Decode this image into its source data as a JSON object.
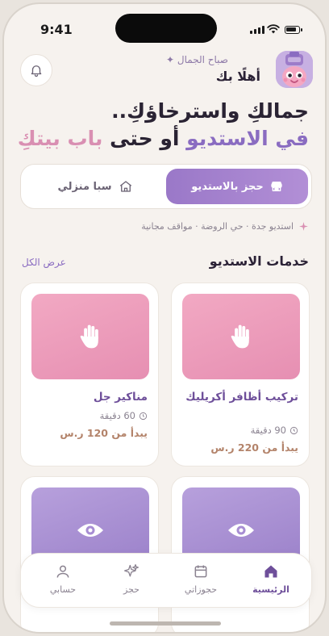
{
  "status": {
    "time": "9:41"
  },
  "header": {
    "greeting_small": "صباح الجمال ✦",
    "greeting_big": "أهلًا بك"
  },
  "hero": {
    "line1": "جمالكِ واسترخاؤكِ..",
    "line2_part1": "في الاستديو",
    "line2_part2": "أو حتى",
    "line2_part3": "باب بيتكِ"
  },
  "toggle": {
    "studio_label": "حجز بالاستديو",
    "home_label": "سبا منزلي"
  },
  "location": {
    "text": "استديو جدة · حي الروضة · مواقف مجانية"
  },
  "section": {
    "title": "خدمات الاستديو",
    "see_all": "عرض الكل"
  },
  "services": [
    {
      "name": "تركيب أظافر أكريليك",
      "duration": "90 دقيقة",
      "price": "يبدأ من 220 ر.س",
      "icon": "hand-icon",
      "color": "pink"
    },
    {
      "name": "مناكير جل",
      "duration": "60 دقيقة",
      "price": "يبدأ من 120 ر.س",
      "icon": "hand-icon",
      "color": "pink"
    },
    {
      "icon": "eye-icon",
      "color": "purple"
    },
    {
      "icon": "eye-icon",
      "color": "purple"
    }
  ],
  "nav": {
    "home": "الرئيسية",
    "bookings": "حجوزاتي",
    "book": "حجز",
    "account": "حسابي"
  },
  "colors": {
    "accent_purple": "#8a6cc1",
    "accent_pink": "#d98fb2",
    "price_brown": "#b3836a",
    "background": "#f6f2ee"
  }
}
